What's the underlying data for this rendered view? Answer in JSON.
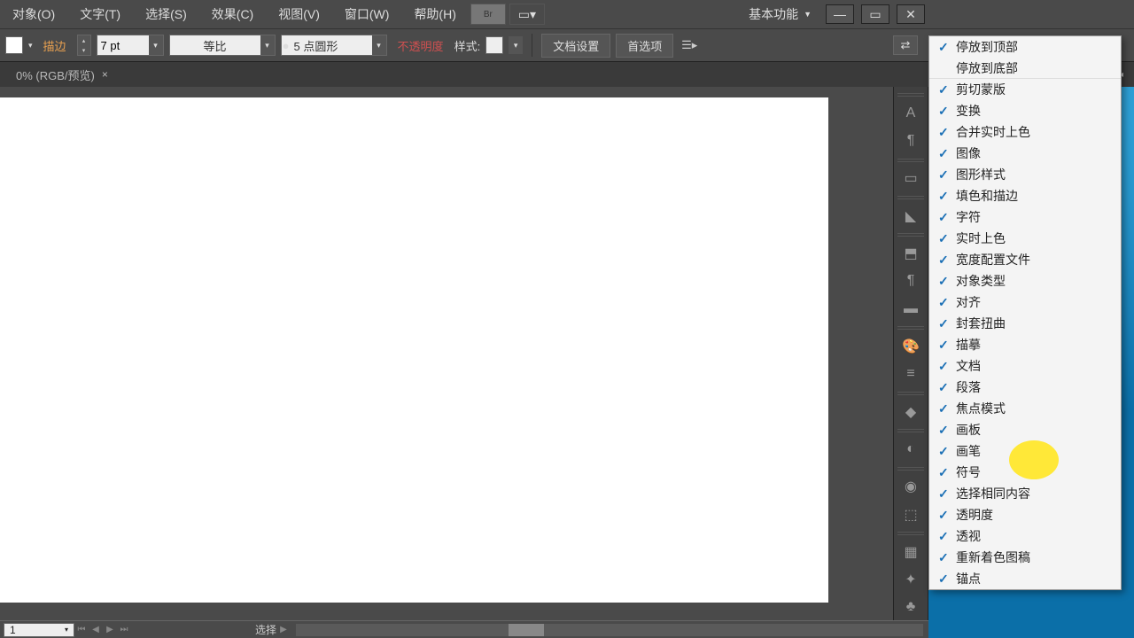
{
  "menubar": {
    "items": [
      "对象(O)",
      "文字(T)",
      "选择(S)",
      "效果(C)",
      "视图(V)",
      "窗口(W)",
      "帮助(H)"
    ],
    "workspace": "基本功能"
  },
  "toolbar": {
    "stroke_label": "描边",
    "stroke_value": "7 pt",
    "scale_label": "等比",
    "brush_value": "5 点圆形",
    "opacity_label": "不透明度",
    "style_label": "样式:",
    "doc_setup": "文档设置",
    "prefs": "首选项"
  },
  "tab": {
    "title": "0% (RGB/预览)"
  },
  "status": {
    "zoom": "1",
    "tool": "选择"
  },
  "menu": {
    "items": [
      {
        "label": "停放到顶部",
        "checked": true,
        "sep": false
      },
      {
        "label": "停放到底部",
        "checked": false,
        "sep": true
      },
      {
        "label": "剪切蒙版",
        "checked": true,
        "sep": false
      },
      {
        "label": "变换",
        "checked": true,
        "sep": false
      },
      {
        "label": "合并实时上色",
        "checked": true,
        "sep": false
      },
      {
        "label": "图像",
        "checked": true,
        "sep": false
      },
      {
        "label": "图形样式",
        "checked": true,
        "sep": false
      },
      {
        "label": "填色和描边",
        "checked": true,
        "sep": false
      },
      {
        "label": "字符",
        "checked": true,
        "sep": false
      },
      {
        "label": "实时上色",
        "checked": true,
        "sep": false
      },
      {
        "label": "宽度配置文件",
        "checked": true,
        "sep": false
      },
      {
        "label": "对象类型",
        "checked": true,
        "sep": false
      },
      {
        "label": "对齐",
        "checked": true,
        "sep": false
      },
      {
        "label": "封套扭曲",
        "checked": true,
        "sep": false
      },
      {
        "label": "描摹",
        "checked": true,
        "sep": false
      },
      {
        "label": "文档",
        "checked": true,
        "sep": false
      },
      {
        "label": "段落",
        "checked": true,
        "sep": false
      },
      {
        "label": "焦点模式",
        "checked": true,
        "sep": false
      },
      {
        "label": "画板",
        "checked": true,
        "sep": false
      },
      {
        "label": "画笔",
        "checked": true,
        "sep": false
      },
      {
        "label": "符号",
        "checked": true,
        "sep": false
      },
      {
        "label": "选择相同内容",
        "checked": true,
        "sep": false
      },
      {
        "label": "透明度",
        "checked": true,
        "sep": false
      },
      {
        "label": "透视",
        "checked": true,
        "sep": false
      },
      {
        "label": "重新着色图稿",
        "checked": true,
        "sep": false
      },
      {
        "label": "锚点",
        "checked": true,
        "sep": false
      }
    ]
  }
}
